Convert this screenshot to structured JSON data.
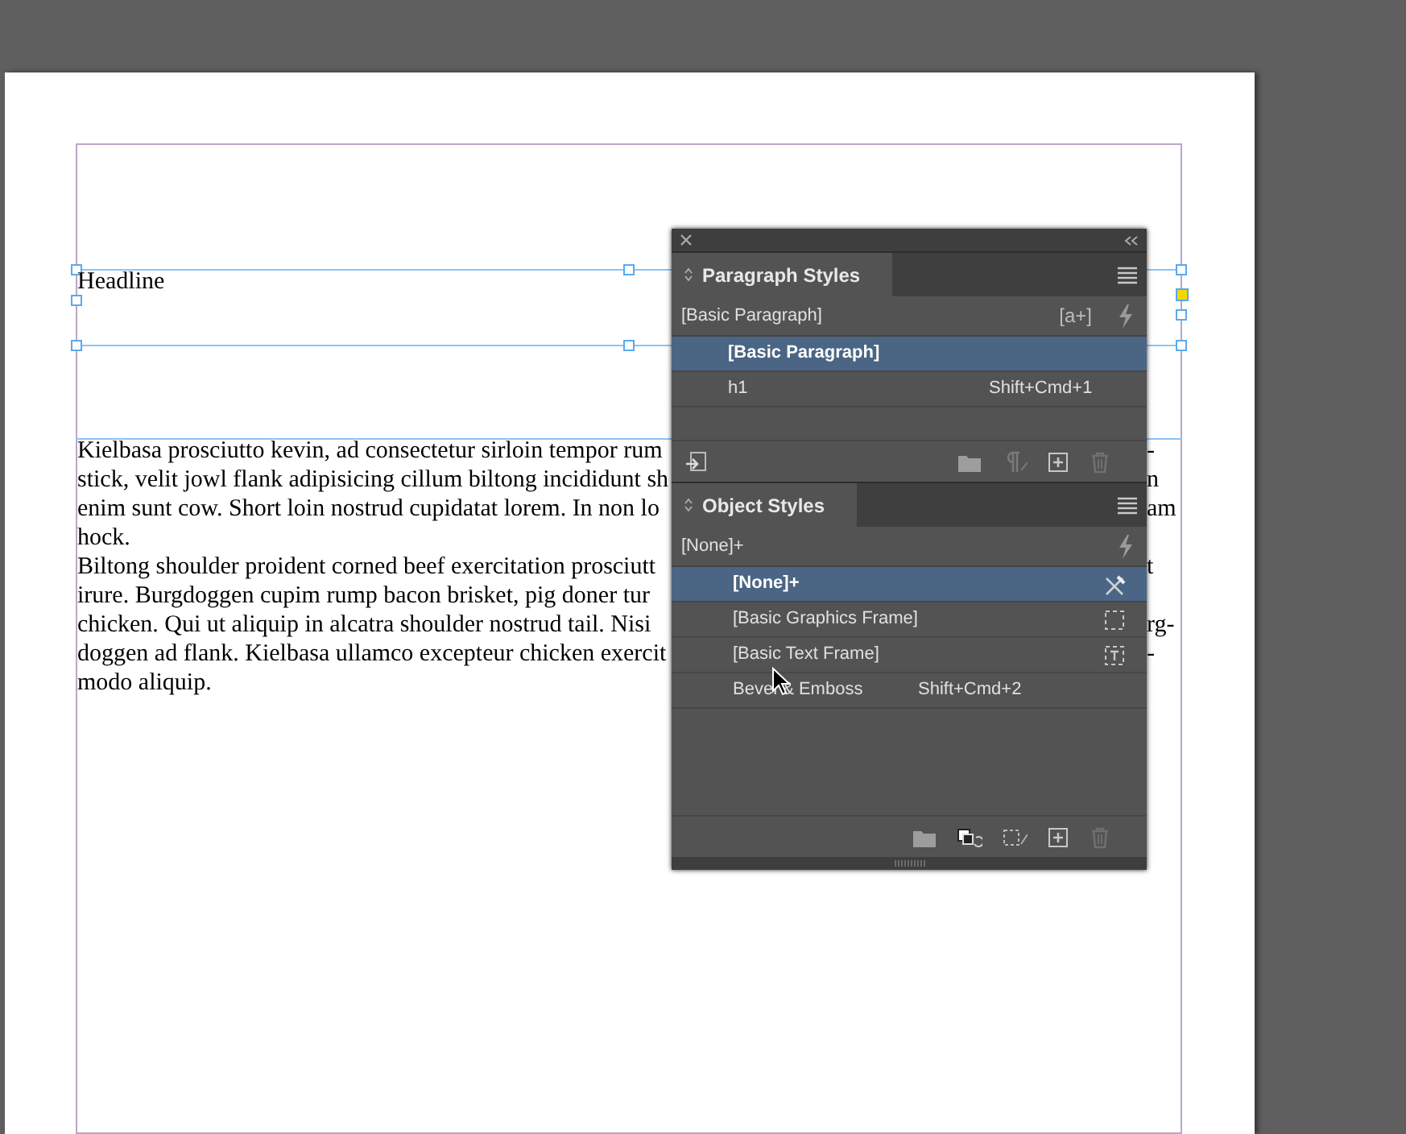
{
  "document": {
    "headline": "Headline",
    "body_lines": [
      {
        "left": "Kielbasa prosciutto kevin, ad consectetur sirloin tempor rum",
        "right": "-"
      },
      {
        "left": "stick, velit jowl flank adipisicing cillum biltong incididunt sh",
        "right": "n"
      },
      {
        "left": "enim sunt cow. Short loin nostrud cupidatat lorem. In non lo",
        "right": "am"
      },
      {
        "left": "hock."
      },
      {
        "left": "Biltong shoulder proident corned beef exercitation prosciutt",
        "right": "t"
      },
      {
        "left": "irure. Burgdoggen cupim rump bacon brisket, pig doner tur"
      },
      {
        "left": "chicken. Qui ut aliquip in alcatra shoulder nostrud tail. Nisi",
        "right": "rg-"
      },
      {
        "left": "doggen ad flank. Kielbasa ullamco excepteur chicken exercit",
        "right": "-"
      },
      {
        "left": "modo aliquip."
      }
    ]
  },
  "panels": [
    {
      "kind": "paragraph",
      "title": "Paragraph Styles",
      "current": "[Basic Paragraph]",
      "badge": "[a+]",
      "items": [
        {
          "label": "[Basic Paragraph]",
          "selected": true
        },
        {
          "label": "h1",
          "shortcut": "Shift+Cmd+1",
          "selected": false
        }
      ]
    },
    {
      "kind": "object",
      "title": "Object Styles",
      "current": "[None]+",
      "items": [
        {
          "label": "[None]+",
          "selected": true,
          "kind": "none"
        },
        {
          "label": "[Basic Graphics Frame]",
          "selected": false,
          "kind": "graphics"
        },
        {
          "label": "[Basic Text Frame]",
          "selected": false,
          "kind": "text"
        },
        {
          "label": "Bevel & Emboss",
          "shortcut": "Shift+Cmd+2",
          "selected": false,
          "kind": "plain"
        }
      ]
    }
  ]
}
